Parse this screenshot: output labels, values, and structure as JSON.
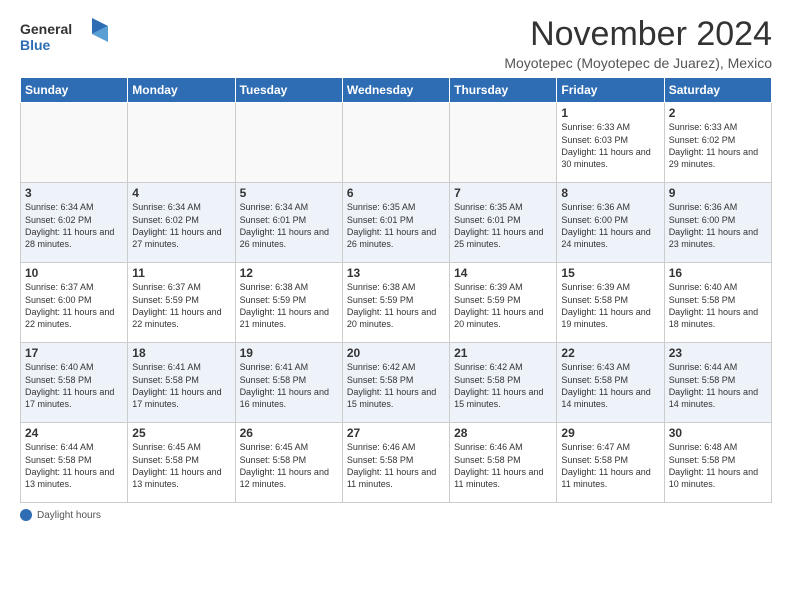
{
  "header": {
    "logo_general": "General",
    "logo_blue": "Blue",
    "month_title": "November 2024",
    "subtitle": "Moyotepec (Moyotepec de Juarez), Mexico"
  },
  "days_of_week": [
    "Sunday",
    "Monday",
    "Tuesday",
    "Wednesday",
    "Thursday",
    "Friday",
    "Saturday"
  ],
  "footer": {
    "dot_label": "Daylight hours"
  },
  "weeks": [
    {
      "days": [
        {
          "number": "",
          "info": ""
        },
        {
          "number": "",
          "info": ""
        },
        {
          "number": "",
          "info": ""
        },
        {
          "number": "",
          "info": ""
        },
        {
          "number": "",
          "info": ""
        },
        {
          "number": "1",
          "info": "Sunrise: 6:33 AM\nSunset: 6:03 PM\nDaylight: 11 hours and 30 minutes."
        },
        {
          "number": "2",
          "info": "Sunrise: 6:33 AM\nSunset: 6:02 PM\nDaylight: 11 hours and 29 minutes."
        }
      ]
    },
    {
      "days": [
        {
          "number": "3",
          "info": "Sunrise: 6:34 AM\nSunset: 6:02 PM\nDaylight: 11 hours and 28 minutes."
        },
        {
          "number": "4",
          "info": "Sunrise: 6:34 AM\nSunset: 6:02 PM\nDaylight: 11 hours and 27 minutes."
        },
        {
          "number": "5",
          "info": "Sunrise: 6:34 AM\nSunset: 6:01 PM\nDaylight: 11 hours and 26 minutes."
        },
        {
          "number": "6",
          "info": "Sunrise: 6:35 AM\nSunset: 6:01 PM\nDaylight: 11 hours and 26 minutes."
        },
        {
          "number": "7",
          "info": "Sunrise: 6:35 AM\nSunset: 6:01 PM\nDaylight: 11 hours and 25 minutes."
        },
        {
          "number": "8",
          "info": "Sunrise: 6:36 AM\nSunset: 6:00 PM\nDaylight: 11 hours and 24 minutes."
        },
        {
          "number": "9",
          "info": "Sunrise: 6:36 AM\nSunset: 6:00 PM\nDaylight: 11 hours and 23 minutes."
        }
      ]
    },
    {
      "days": [
        {
          "number": "10",
          "info": "Sunrise: 6:37 AM\nSunset: 6:00 PM\nDaylight: 11 hours and 22 minutes."
        },
        {
          "number": "11",
          "info": "Sunrise: 6:37 AM\nSunset: 5:59 PM\nDaylight: 11 hours and 22 minutes."
        },
        {
          "number": "12",
          "info": "Sunrise: 6:38 AM\nSunset: 5:59 PM\nDaylight: 11 hours and 21 minutes."
        },
        {
          "number": "13",
          "info": "Sunrise: 6:38 AM\nSunset: 5:59 PM\nDaylight: 11 hours and 20 minutes."
        },
        {
          "number": "14",
          "info": "Sunrise: 6:39 AM\nSunset: 5:59 PM\nDaylight: 11 hours and 20 minutes."
        },
        {
          "number": "15",
          "info": "Sunrise: 6:39 AM\nSunset: 5:58 PM\nDaylight: 11 hours and 19 minutes."
        },
        {
          "number": "16",
          "info": "Sunrise: 6:40 AM\nSunset: 5:58 PM\nDaylight: 11 hours and 18 minutes."
        }
      ]
    },
    {
      "days": [
        {
          "number": "17",
          "info": "Sunrise: 6:40 AM\nSunset: 5:58 PM\nDaylight: 11 hours and 17 minutes."
        },
        {
          "number": "18",
          "info": "Sunrise: 6:41 AM\nSunset: 5:58 PM\nDaylight: 11 hours and 17 minutes."
        },
        {
          "number": "19",
          "info": "Sunrise: 6:41 AM\nSunset: 5:58 PM\nDaylight: 11 hours and 16 minutes."
        },
        {
          "number": "20",
          "info": "Sunrise: 6:42 AM\nSunset: 5:58 PM\nDaylight: 11 hours and 15 minutes."
        },
        {
          "number": "21",
          "info": "Sunrise: 6:42 AM\nSunset: 5:58 PM\nDaylight: 11 hours and 15 minutes."
        },
        {
          "number": "22",
          "info": "Sunrise: 6:43 AM\nSunset: 5:58 PM\nDaylight: 11 hours and 14 minutes."
        },
        {
          "number": "23",
          "info": "Sunrise: 6:44 AM\nSunset: 5:58 PM\nDaylight: 11 hours and 14 minutes."
        }
      ]
    },
    {
      "days": [
        {
          "number": "24",
          "info": "Sunrise: 6:44 AM\nSunset: 5:58 PM\nDaylight: 11 hours and 13 minutes."
        },
        {
          "number": "25",
          "info": "Sunrise: 6:45 AM\nSunset: 5:58 PM\nDaylight: 11 hours and 13 minutes."
        },
        {
          "number": "26",
          "info": "Sunrise: 6:45 AM\nSunset: 5:58 PM\nDaylight: 11 hours and 12 minutes."
        },
        {
          "number": "27",
          "info": "Sunrise: 6:46 AM\nSunset: 5:58 PM\nDaylight: 11 hours and 11 minutes."
        },
        {
          "number": "28",
          "info": "Sunrise: 6:46 AM\nSunset: 5:58 PM\nDaylight: 11 hours and 11 minutes."
        },
        {
          "number": "29",
          "info": "Sunrise: 6:47 AM\nSunset: 5:58 PM\nDaylight: 11 hours and 11 minutes."
        },
        {
          "number": "30",
          "info": "Sunrise: 6:48 AM\nSunset: 5:58 PM\nDaylight: 11 hours and 10 minutes."
        }
      ]
    }
  ]
}
